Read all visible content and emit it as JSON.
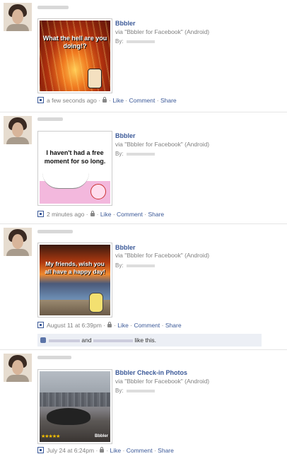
{
  "posts": [
    {
      "app_title": "Bbbler",
      "via": "via \"Bbbler for Facebook\" (Android)",
      "by": "By:",
      "image_text": "What the hell are you doing!?",
      "time": "a few seconds ago",
      "actions": [
        "Like",
        "Comment",
        "Share"
      ]
    },
    {
      "app_title": "Bbbler",
      "via": "via \"Bbbler for Facebook\" (Android)",
      "by": "By:",
      "image_text": "I haven't had a free moment for so long.",
      "time": "2 minutes ago",
      "actions": [
        "Like",
        "Comment",
        "Share"
      ]
    },
    {
      "app_title": "Bbbler",
      "via": "via \"Bbbler for Facebook\" (Android)",
      "by": "By:",
      "image_text": "My friends, wish you all have a happy day!",
      "time": "August 11 at 6:39pm",
      "actions": [
        "Like",
        "Comment",
        "Share"
      ],
      "likes": {
        "and": "and",
        "suffix": "like this."
      }
    },
    {
      "app_title": "Bbbler Check-in Photos",
      "via": "via \"Bbbler for Facebook\" (Android)",
      "by": "By:",
      "image_brand": "Bbbler",
      "image_stars": "★★★★★",
      "time": "July 24 at 6:24pm",
      "actions": [
        "Like",
        "Comment",
        "Share"
      ]
    }
  ],
  "separator": "·",
  "colors": {
    "link": "#3b5998",
    "meta": "#808080",
    "likes_bg": "#eceff5"
  }
}
